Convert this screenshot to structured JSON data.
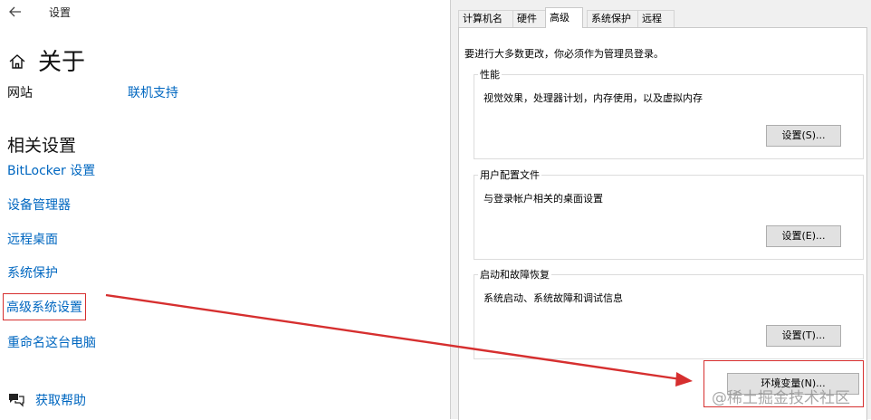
{
  "settings": {
    "window_title": "设置",
    "page_title": "关于",
    "info_row": {
      "label": "网站",
      "link": "联机支持"
    },
    "related_title": "相关设置",
    "links": [
      "BitLocker 设置",
      "设备管理器",
      "远程桌面",
      "系统保护",
      "高级系统设置",
      "重命名这台电脑"
    ],
    "highlighted_link_index": 4,
    "help_link": "获取帮助"
  },
  "dialog": {
    "tabs": [
      "计算机名",
      "硬件",
      "高级",
      "系统保护",
      "远程"
    ],
    "active_tab_index": 2,
    "admin_note": "要进行大多数更改，你必须作为管理员登录。",
    "groups": {
      "performance": {
        "title": "性能",
        "desc": "视觉效果，处理器计划，内存使用，以及虚拟内存",
        "button": "设置(S)..."
      },
      "profiles": {
        "title": "用户配置文件",
        "desc": "与登录帐户相关的桌面设置",
        "button": "设置(E)..."
      },
      "startup": {
        "title": "启动和故障恢复",
        "desc": "系统启动、系统故障和调试信息",
        "button": "设置(T)..."
      }
    },
    "env_button": "环境变量(N)..."
  },
  "annotation": {
    "color": "#d62f2f"
  },
  "watermark": "@稀土掘金技术社区",
  "colors": {
    "link": "#0067c0",
    "dialog_bg": "#f0f0f0",
    "button_bg": "#e1e1e1"
  }
}
